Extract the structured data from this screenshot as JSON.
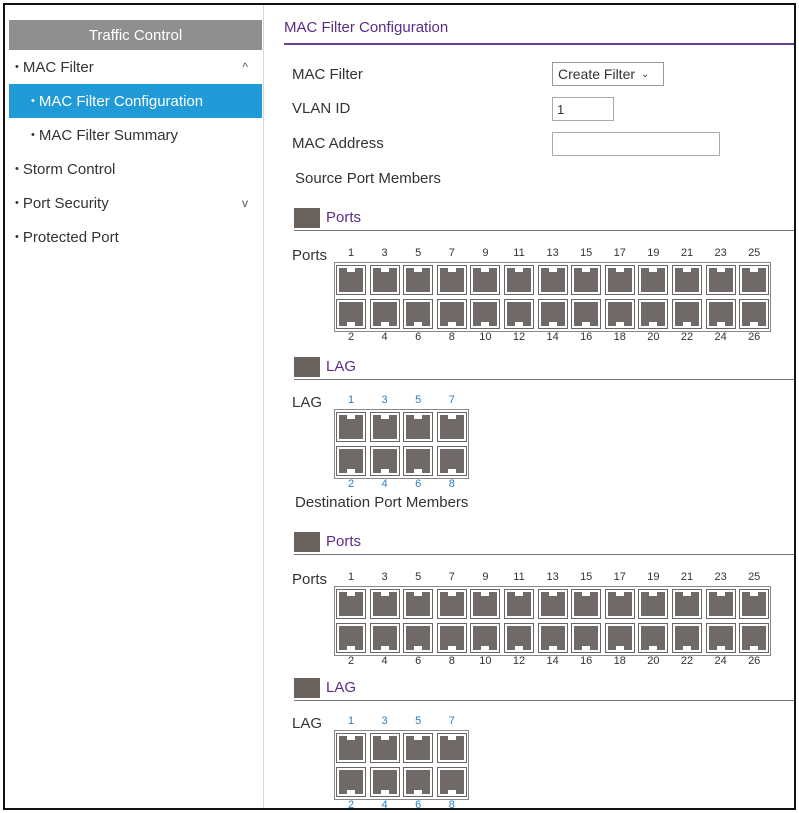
{
  "sidebar": {
    "header": "Traffic Control",
    "items": [
      {
        "label": "MAC Filter",
        "level": 0,
        "bullet": "•",
        "chevron": "^"
      },
      {
        "label": "MAC Filter Configuration",
        "level": 1,
        "bullet": "•",
        "active": true
      },
      {
        "label": "MAC Filter Summary",
        "level": 1,
        "bullet": "•"
      },
      {
        "label": "Storm Control",
        "level": 0,
        "bullet": "•"
      },
      {
        "label": "Port Security",
        "level": 0,
        "bullet": "•",
        "chevron": "v"
      },
      {
        "label": "Protected Port",
        "level": 0,
        "bullet": "•"
      }
    ]
  },
  "main": {
    "title": "MAC Filter Configuration",
    "mac_filter_label": "MAC Filter",
    "mac_filter_select": "Create Filter",
    "vlan_label": "VLAN ID",
    "vlan_value": "1",
    "mac_address_label": "MAC Address",
    "mac_address_value": "",
    "source_label": "Source Port Members",
    "dest_label": "Destination Port Members",
    "ports_section": "Ports",
    "lag_section": "LAG",
    "ports_row_label": "Ports",
    "lag_row_label": "LAG",
    "ports_top": [
      "1",
      "3",
      "5",
      "7",
      "9",
      "11",
      "13",
      "15",
      "17",
      "19",
      "21",
      "23",
      "25"
    ],
    "ports_bottom": [
      "2",
      "4",
      "6",
      "8",
      "10",
      "12",
      "14",
      "16",
      "18",
      "20",
      "22",
      "24",
      "26"
    ],
    "lag_top": [
      "1",
      "3",
      "5",
      "7"
    ],
    "lag_bottom": [
      "2",
      "4",
      "6",
      "8"
    ]
  },
  "colors": {
    "accent_purple": "#5b2c86",
    "active_blue": "#219bd7",
    "port_gray": "#6f6a67",
    "lag_number_blue": "#2a7fc4"
  }
}
